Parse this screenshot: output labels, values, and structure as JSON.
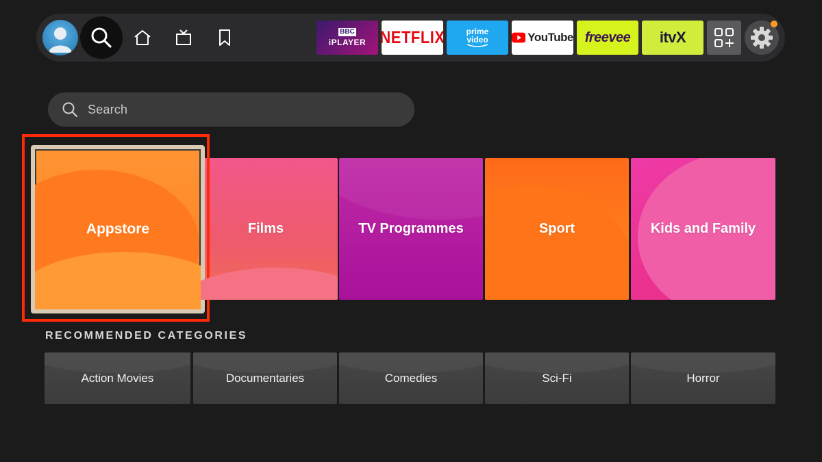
{
  "topbar": {
    "apps": [
      {
        "name": "BBC iPlayer",
        "line1": "BBC",
        "line2": "iPLAYER"
      },
      {
        "name": "Netflix",
        "text": "NETFLIX",
        "color": "#e50914"
      },
      {
        "name": "Prime Video",
        "line1": "prime",
        "line2": "video"
      },
      {
        "name": "YouTube",
        "text": "YouTube"
      },
      {
        "name": "Freevee",
        "text": "freevee"
      },
      {
        "name": "ITVX",
        "text": "itvX"
      }
    ],
    "notification_color": "#ff9a1f"
  },
  "search": {
    "placeholder": "Search"
  },
  "categories": [
    {
      "label": "Appstore",
      "focused": true
    },
    {
      "label": "Films"
    },
    {
      "label": "TV Programmes"
    },
    {
      "label": "Sport"
    },
    {
      "label": "Kids and Family"
    }
  ],
  "recommended": {
    "heading": "RECOMMENDED CATEGORIES",
    "items": [
      {
        "label": "Action Movies"
      },
      {
        "label": "Documentaries"
      },
      {
        "label": "Comedies"
      },
      {
        "label": "Sci-Fi"
      },
      {
        "label": "Horror"
      }
    ]
  },
  "colors": {
    "focus_outline": "#ff2a0a",
    "background": "#1b1b1c"
  }
}
